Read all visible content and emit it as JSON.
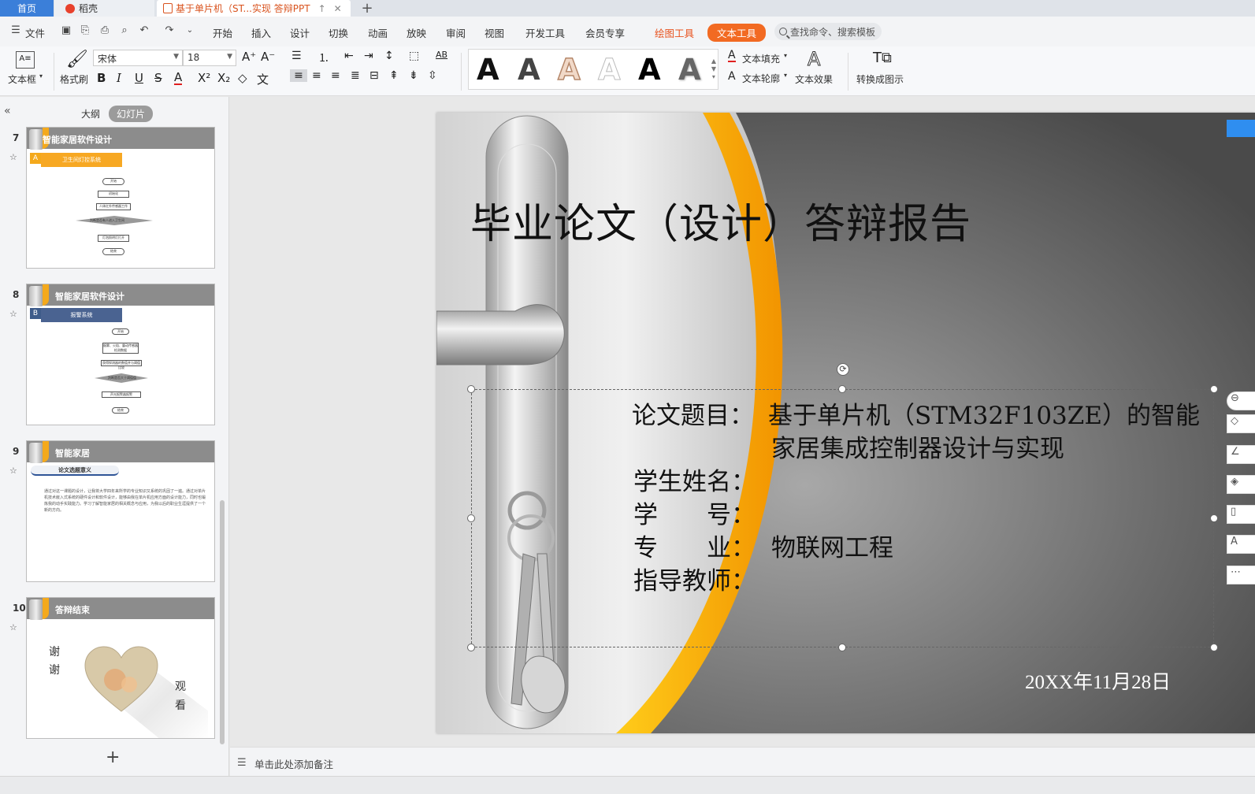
{
  "tabs": {
    "home": "首页",
    "daoke": "稻壳",
    "document": "基于单片机（ST...实现 答辩PPT",
    "add": "+"
  },
  "menu": {
    "file": "文件",
    "items": [
      "开始",
      "插入",
      "设计",
      "切换",
      "动画",
      "放映",
      "审阅",
      "视图",
      "开发工具",
      "会员专享"
    ],
    "draw_tool": "绘图工具",
    "text_tool": "文本工具",
    "search_placeholder": "查找命令、搜索模板"
  },
  "toolbar": {
    "textbox": "文本框",
    "format_painter": "格式刷",
    "font_name": "宋体",
    "font_size": "18",
    "text_fill": "文本填充",
    "text_outline": "文本轮廓",
    "text_effect": "文本效果",
    "convert_smartart": "转换成图示",
    "style_glyph": "A",
    "accent_color": "#f26a22"
  },
  "left_panel": {
    "tab_outline": "大纲",
    "tab_slides": "幻灯片",
    "slides": [
      {
        "number": "7",
        "title": "智能家居软件设计",
        "badge": "A",
        "section": "卫生间灯控系统"
      },
      {
        "number": "8",
        "title": "智能家居软件设计",
        "badge": "B",
        "section": "报警系统"
      },
      {
        "number": "9",
        "title": "智能家居",
        "section": "论文选题意义",
        "body": "通过对这一课题的设计，让我将大学四年来所学的专业知识又系统的巩固了一遍。通过对单片机技术嵌入式系统的硬件设计和软件设计，能够由我在单片机应用方面的设计能力，同时也锻炼我的动手实践能力。学习了解智能家居的相关概念与应用，为我以后的职业生涯提供了一个新的方向。"
      },
      {
        "number": "10",
        "title": "答辩结束",
        "thanks": [
          "谢",
          "谢"
        ],
        "watch": [
          "观",
          "看"
        ]
      }
    ],
    "flow7": [
      "开始",
      "初始化",
      "人体红外传感器工作",
      "判断是否有人进入卫生间",
      "灯泡照明灯打开",
      "结束"
    ],
    "flow8": [
      "开始",
      "烟雾、火焰、震动传感器检测数据",
      "获得探测器的数值并与阈值比较",
      "判断是否大于阈值值",
      "声光报警器报警",
      "结束"
    ]
  },
  "slide": {
    "title": "毕业论文（设计）答辩报告",
    "topic_label": "论文题目：",
    "topic_line1": "基于单片机（STM32F103ZE）的智能",
    "topic_line2": "家居集成控制器设计与实现",
    "name_label": "学生姓名：",
    "id_label": "学　　号：",
    "major_label": "专　　业：",
    "major_value": "物联网工程",
    "advisor_label": "指导教师：",
    "date": "20XX年11月28日"
  },
  "notes": {
    "placeholder": "单击此处添加备注"
  }
}
